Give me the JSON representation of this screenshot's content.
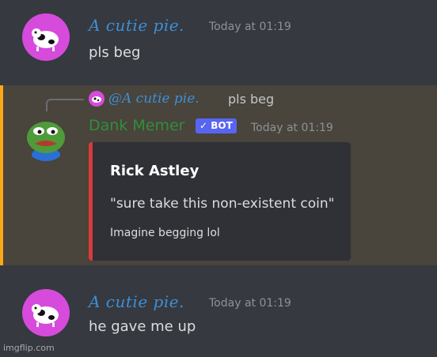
{
  "messages": [
    {
      "username": "A cutie pie.",
      "timestamp": "Today at 01:19",
      "content": "pls beg"
    },
    {
      "reply_to": {
        "username": "@A cutie pie.",
        "content": "pls beg"
      },
      "username": "Dank Memer",
      "badge": "✓ BOT",
      "timestamp": "Today at 01:19",
      "embed": {
        "title": "Rick Astley",
        "description": "\"sure take this non-existent coin\"",
        "footer": "Imagine begging lol",
        "accent_color": "#d93a3a"
      }
    },
    {
      "username": "A cutie pie.",
      "timestamp": "Today at 01:19",
      "content": "he gave me up"
    }
  ],
  "watermark": "imgflip.com",
  "colors": {
    "background": "#36393f",
    "highlight": "#49443c",
    "highlight_border": "#faa81a",
    "username": "#3e8fd6",
    "bot_name": "#2f8f3a",
    "bot_badge": "#5865f2"
  },
  "icons": {
    "user_avatar": "cow-avatar-icon",
    "bot_avatar": "pepe-frog-avatar-icon"
  }
}
